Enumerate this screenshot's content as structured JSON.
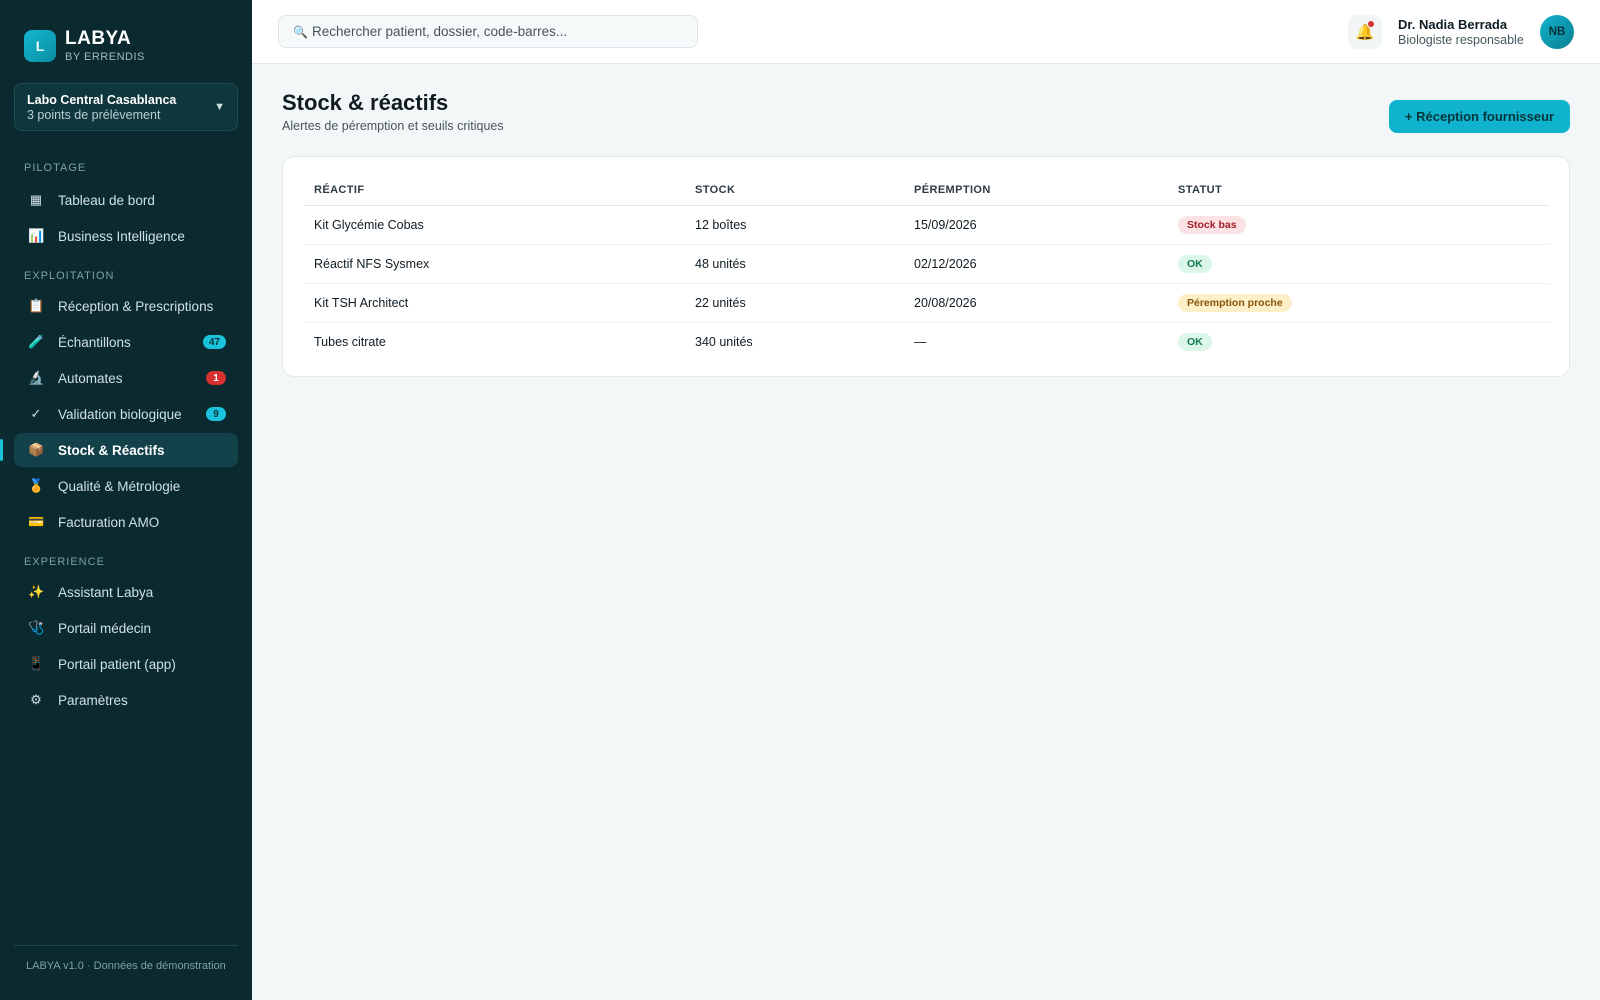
{
  "brand": {
    "logo_letter": "L",
    "name": "LABYA",
    "sub": "BY ERRENDIS"
  },
  "lab": {
    "name": "Labo Central Casablanca",
    "points": "3 points de prélèvement"
  },
  "sidebar": {
    "sections": [
      {
        "label": "PILOTAGE"
      },
      {
        "label": "EXPLOITATION"
      },
      {
        "label": "EXPERIENCE"
      }
    ],
    "items": [
      {
        "icon": "▦",
        "icon_name": "grid-icon",
        "label": "Tableau de bord"
      },
      {
        "icon": "📊",
        "icon_name": "bar-chart-icon",
        "label": "Business Intelligence"
      },
      {
        "icon": "📋",
        "icon_name": "clipboard-icon",
        "label": "Réception & Prescriptions"
      },
      {
        "icon": "🧪",
        "icon_name": "test-tube-icon",
        "label": "Échantillons",
        "badge": "47"
      },
      {
        "icon": "🔬",
        "icon_name": "microscope-icon",
        "label": "Automates",
        "badge": "1"
      },
      {
        "icon": "✓",
        "icon_name": "check-icon",
        "label": "Validation biologique",
        "badge": "9"
      },
      {
        "icon": "📦",
        "icon_name": "package-icon",
        "label": "Stock & Réactifs",
        "active": true
      },
      {
        "icon": "🏅",
        "icon_name": "medal-icon",
        "label": "Qualité & Métrologie"
      },
      {
        "icon": "💳",
        "icon_name": "credit-card-icon",
        "label": "Facturation AMO"
      },
      {
        "icon": "✨",
        "icon_name": "sparkles-icon",
        "label": "Assistant Labya"
      },
      {
        "icon": "🩺",
        "icon_name": "stethoscope-icon",
        "label": "Portail médecin"
      },
      {
        "icon": "📱",
        "icon_name": "phone-icon",
        "label": "Portail patient (app)"
      },
      {
        "icon": "⚙",
        "icon_name": "gear-icon",
        "label": "Paramètres"
      }
    ],
    "footer": "LABYA v1.0 · Données de démonstration"
  },
  "topbar": {
    "search_icon": "🔍",
    "search_placeholder": "Rechercher patient, dossier, code-barres...",
    "bell_icon": "🔔",
    "user_name": "Dr. Nadia Berrada",
    "user_role": "Biologiste responsable",
    "avatar_initials": "NB"
  },
  "page": {
    "title": "Stock & réactifs",
    "subtitle": "Alertes de péremption et seuils critiques",
    "primary_button": "+ Réception fournisseur"
  },
  "table": {
    "headers": [
      "RÉACTIF",
      "STOCK",
      "PÉREMPTION",
      "STATUT"
    ],
    "rows": [
      {
        "reactif": "Kit Glycémie Cobas",
        "stock": "12 boîtes",
        "peremption": "15/09/2026",
        "statut": "Stock bas",
        "statut_type": "danger"
      },
      {
        "reactif": "Réactif NFS Sysmex",
        "stock": "48 unités",
        "peremption": "02/12/2026",
        "statut": "OK",
        "statut_type": "ok"
      },
      {
        "reactif": "Kit TSH Architect",
        "stock": "22 unités",
        "peremption": "20/08/2026",
        "statut": "Péremption proche",
        "statut_type": "warn"
      },
      {
        "reactif": "Tubes citrate",
        "stock": "340 unités",
        "peremption": "—",
        "statut": "OK",
        "statut_type": "ok"
      }
    ]
  },
  "colors": {
    "sidebar_bg": "#0a2a30",
    "accent": "#0fb3cd",
    "danger": "#d63030"
  }
}
